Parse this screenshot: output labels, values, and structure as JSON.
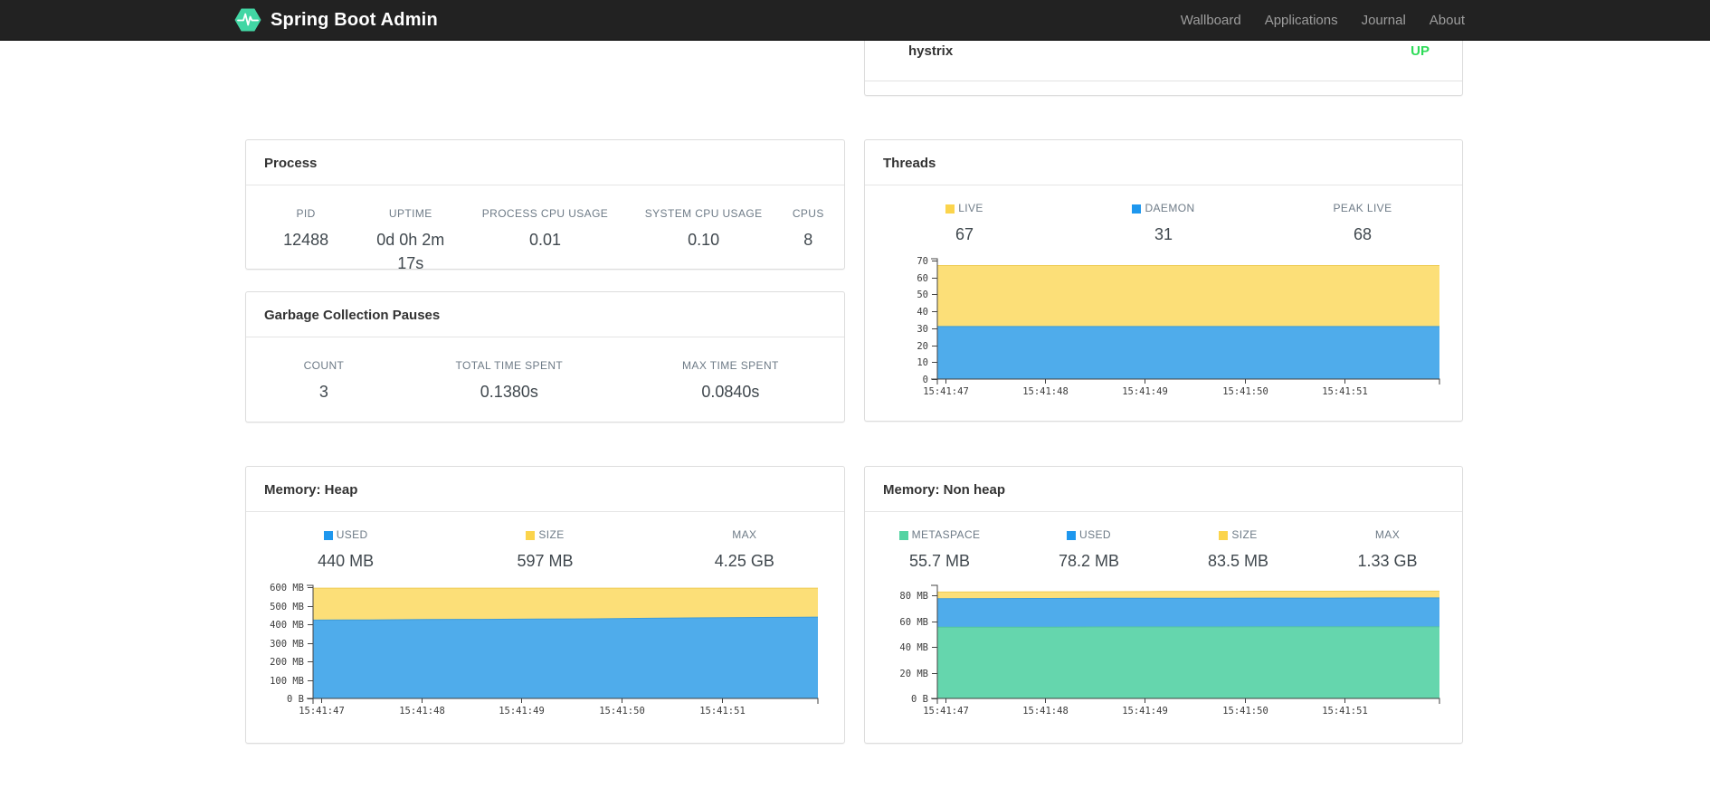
{
  "navbar": {
    "brand": "Spring Boot Admin",
    "brand_color": "#42D6A4",
    "links": [
      {
        "id": "wallboard",
        "label": "Wallboard"
      },
      {
        "id": "applications",
        "label": "Applications"
      },
      {
        "id": "journal",
        "label": "Journal"
      },
      {
        "id": "about",
        "label": "About"
      }
    ]
  },
  "status_card": {
    "application": "hystrix",
    "status": "UP",
    "status_color": "#2EDB58"
  },
  "cards": {
    "process": {
      "title": "Process",
      "metrics": [
        {
          "label": "PID",
          "value": "12488"
        },
        {
          "label": "UPTIME",
          "value": "0d 0h 2m 17s"
        },
        {
          "label": "PROCESS CPU USAGE",
          "value": "0.01"
        },
        {
          "label": "SYSTEM CPU USAGE",
          "value": "0.10"
        },
        {
          "label": "CPUS",
          "value": "8"
        }
      ]
    },
    "gc": {
      "title": "Garbage Collection Pauses",
      "metrics": [
        {
          "label": "COUNT",
          "value": "3"
        },
        {
          "label": "TOTAL TIME SPENT",
          "value": "0.1380s"
        },
        {
          "label": "MAX TIME SPENT",
          "value": "0.0840s"
        }
      ]
    },
    "threads": {
      "title": "Threads",
      "legend": [
        {
          "label": "LIVE",
          "value": "67",
          "color": "#FBD44C"
        },
        {
          "label": "DAEMON",
          "value": "31",
          "color": "#1E97EE"
        },
        {
          "label": "PEAK LIVE",
          "value": "68",
          "color": null
        }
      ]
    },
    "heap": {
      "title": "Memory: Heap",
      "legend": [
        {
          "label": "USED",
          "value": "440 MB",
          "color": "#1E97EE"
        },
        {
          "label": "SIZE",
          "value": "597 MB",
          "color": "#FBD44C"
        },
        {
          "label": "MAX",
          "value": "4.25 GB",
          "color": null
        }
      ]
    },
    "nonheap": {
      "title": "Memory: Non heap",
      "legend": [
        {
          "label": "METASPACE",
          "value": "55.7 MB",
          "color": "#53D3A2"
        },
        {
          "label": "USED",
          "value": "78.2 MB",
          "color": "#1E97EE"
        },
        {
          "label": "SIZE",
          "value": "83.5 MB",
          "color": "#FBD44C"
        },
        {
          "label": "MAX",
          "value": "1.33 GB",
          "color": null
        }
      ]
    }
  },
  "chart_data": [
    {
      "id": "threads",
      "type": "area",
      "title": "Threads",
      "stacked": true,
      "grid": false,
      "legend_position": "top",
      "x_tick_labels": [
        "15:41:47",
        "15:41:48",
        "15:41:49",
        "15:41:50",
        "15:41:51"
      ],
      "x_tick_fractions": [
        0.016,
        0.215,
        0.413,
        0.612,
        0.81
      ],
      "ymax": 71,
      "y_ticks": [
        {
          "value": 0,
          "label": "0"
        },
        {
          "value": 10,
          "label": "10"
        },
        {
          "value": 20,
          "label": "20"
        },
        {
          "value": 30,
          "label": "30"
        },
        {
          "value": 40,
          "label": "40"
        },
        {
          "value": 50,
          "label": "50"
        },
        {
          "value": 60,
          "label": "60"
        },
        {
          "value": 70,
          "label": "70"
        }
      ],
      "layers": [
        {
          "name": "LIVE",
          "fill": "#FCDF78",
          "stroke": "#EECC55",
          "values": [
            67,
            67,
            67,
            67,
            67,
            67,
            67,
            67,
            67,
            67
          ]
        },
        {
          "name": "DAEMON",
          "fill": "#4FACEB",
          "stroke": "#3E9BD8",
          "values": [
            31,
            31,
            31,
            31,
            31,
            31,
            31,
            31,
            31,
            31
          ]
        }
      ]
    },
    {
      "id": "heap",
      "type": "area",
      "title": "Memory: Heap",
      "stacked": false,
      "grid": false,
      "legend_position": "top",
      "units": "MB",
      "x_tick_labels": [
        "15:41:47",
        "15:41:48",
        "15:41:49",
        "15:41:50",
        "15:41:51"
      ],
      "x_tick_fractions": [
        0.016,
        0.215,
        0.413,
        0.612,
        0.81
      ],
      "ymax": 612,
      "y_ticks": [
        {
          "value": 0,
          "label": "0 B"
        },
        {
          "value": 100,
          "label": "100 MB"
        },
        {
          "value": 200,
          "label": "200 MB"
        },
        {
          "value": 300,
          "label": "300 MB"
        },
        {
          "value": 400,
          "label": "400 MB"
        },
        {
          "value": 500,
          "label": "500 MB"
        },
        {
          "value": 600,
          "label": "600 MB"
        }
      ],
      "layers": [
        {
          "name": "SIZE",
          "fill": "#FCDF78",
          "stroke": "#EECC55",
          "values": [
            597,
            597,
            597,
            597,
            597,
            597,
            597,
            597,
            597,
            597
          ]
        },
        {
          "name": "USED",
          "fill": "#4FACEB",
          "stroke": "#3E9BD8",
          "values": [
            424,
            425,
            427,
            428,
            430,
            431,
            434,
            436,
            438,
            440
          ]
        }
      ]
    },
    {
      "id": "nonheap",
      "type": "area",
      "title": "Memory: Non heap",
      "stacked": false,
      "grid": false,
      "legend_position": "top",
      "units": "MB",
      "x_tick_labels": [
        "15:41:47",
        "15:41:48",
        "15:41:49",
        "15:41:50",
        "15:41:51"
      ],
      "x_tick_fractions": [
        0.016,
        0.215,
        0.413,
        0.612,
        0.81
      ],
      "ymax": 88,
      "y_ticks": [
        {
          "value": 0,
          "label": "0 B"
        },
        {
          "value": 20,
          "label": "20 MB"
        },
        {
          "value": 40,
          "label": "40 MB"
        },
        {
          "value": 60,
          "label": "60 MB"
        },
        {
          "value": 80,
          "label": "80 MB"
        }
      ],
      "layers": [
        {
          "name": "SIZE",
          "fill": "#FCDF78",
          "stroke": "#EECC55",
          "values": [
            82.8,
            82.9,
            83.0,
            83.1,
            83.2,
            83.3,
            83.4,
            83.4,
            83.5,
            83.5
          ]
        },
        {
          "name": "USED",
          "fill": "#4FACEB",
          "stroke": "#3E9BD8",
          "values": [
            77.6,
            77.7,
            77.8,
            77.9,
            78.0,
            78.0,
            78.1,
            78.1,
            78.2,
            78.2
          ]
        },
        {
          "name": "METASPACE",
          "fill": "#65D6AD",
          "stroke": "#55C69C",
          "values": [
            55.4,
            55.5,
            55.5,
            55.6,
            55.6,
            55.6,
            55.7,
            55.7,
            55.7,
            55.7
          ]
        }
      ]
    }
  ]
}
